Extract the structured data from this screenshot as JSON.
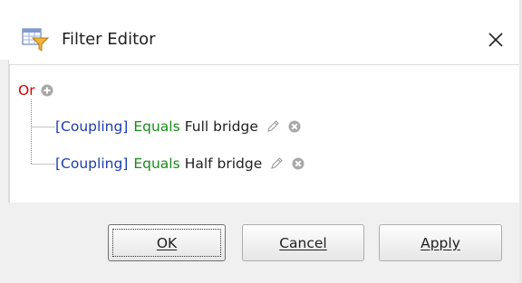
{
  "window": {
    "title": "Filter Editor"
  },
  "tree": {
    "group_operator": "Or",
    "conditions": [
      {
        "field": "[Coupling]",
        "operator": "Equals",
        "value": "Full bridge"
      },
      {
        "field": "[Coupling]",
        "operator": "Equals",
        "value": "Half bridge"
      }
    ]
  },
  "buttons": {
    "ok": "OK",
    "cancel": "Cancel",
    "apply": "Apply"
  },
  "icons": {
    "title": "filter-table-icon",
    "close": "close-icon",
    "add": "add-circle-icon",
    "edit": "pencil-icon",
    "delete": "remove-circle-icon"
  },
  "colors": {
    "group_operator": "#d00000",
    "field": "#1a3cb0",
    "operator": "#1a8a1a"
  }
}
